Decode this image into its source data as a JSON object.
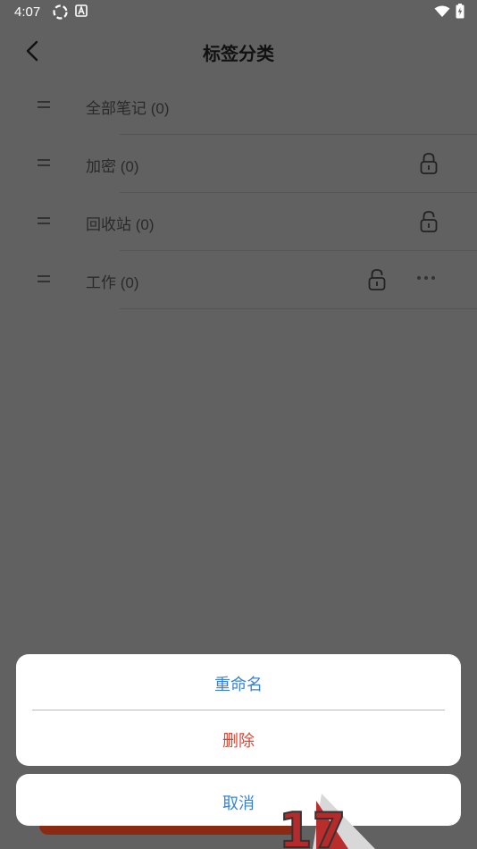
{
  "status": {
    "time": "4:07"
  },
  "header": {
    "title": "标签分类"
  },
  "list": {
    "items": [
      {
        "label": "全部笔记 (0)"
      },
      {
        "label": "加密 (0)"
      },
      {
        "label": "回收站 (0)"
      },
      {
        "label": "工作 (0)"
      }
    ]
  },
  "sheet": {
    "rename_label": "重命名",
    "delete_label": "删除",
    "cancel_label": "取消"
  },
  "badge": {
    "text": "17"
  },
  "colors": {
    "overlay": "#616161",
    "action_blue": "#3a83d6",
    "action_red": "#e0432f"
  }
}
